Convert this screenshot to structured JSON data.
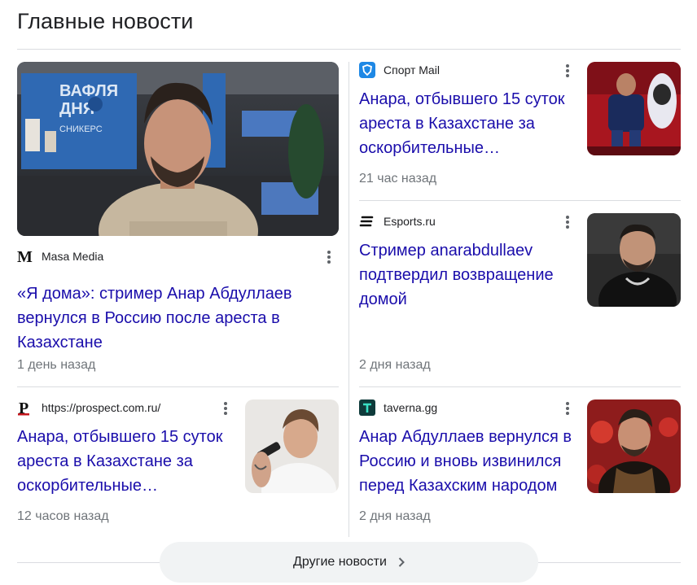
{
  "section": {
    "title": "Главные новости"
  },
  "featured": {
    "source": "Masa Media",
    "headline": "«Я дома»: стример Анар Абдуллаев вернулся в Россию после ареста в Казахстане",
    "time": "1 день назад",
    "image_text": {
      "line1": "ВАФЛЯ",
      "line2": "ДНЯ",
      "line3": "СНИКЕРС"
    }
  },
  "articles": [
    {
      "source": "Спорт Mail",
      "headline": "Анара, отбывшего 15 суток ареста в Казахстане за оскорбительные…",
      "time": "21 час назад"
    },
    {
      "source": "Esports.ru",
      "headline": "Стример anarabdullaev подтвердил возвращение домой",
      "time": "2 дня назад"
    },
    {
      "source": "https://prospect.com.ru/",
      "headline": "Анара, отбывшего 15 суток ареста в Казахстане за оскорбительные…",
      "time": "12 часов назад"
    },
    {
      "source": "taverna.gg",
      "headline": "Анар Абдуллаев вернулся в Россию и вновь извинился перед Казахским народом",
      "time": "2 дня назад"
    }
  ],
  "more_button": {
    "label": "Другие новости"
  },
  "icons": {
    "masa_logo": "M",
    "mail_logo": "mail-sport-icon",
    "esports_logo": "esports-icon",
    "prospect_logo": "P",
    "taverna_logo": "T",
    "more_options": "more-vert-icon",
    "chevron": "chevron-right-icon"
  },
  "colors": {
    "link": "#1a0dab",
    "meta": "#70757a",
    "divider": "#dadce0",
    "button_bg": "#f1f3f4"
  }
}
